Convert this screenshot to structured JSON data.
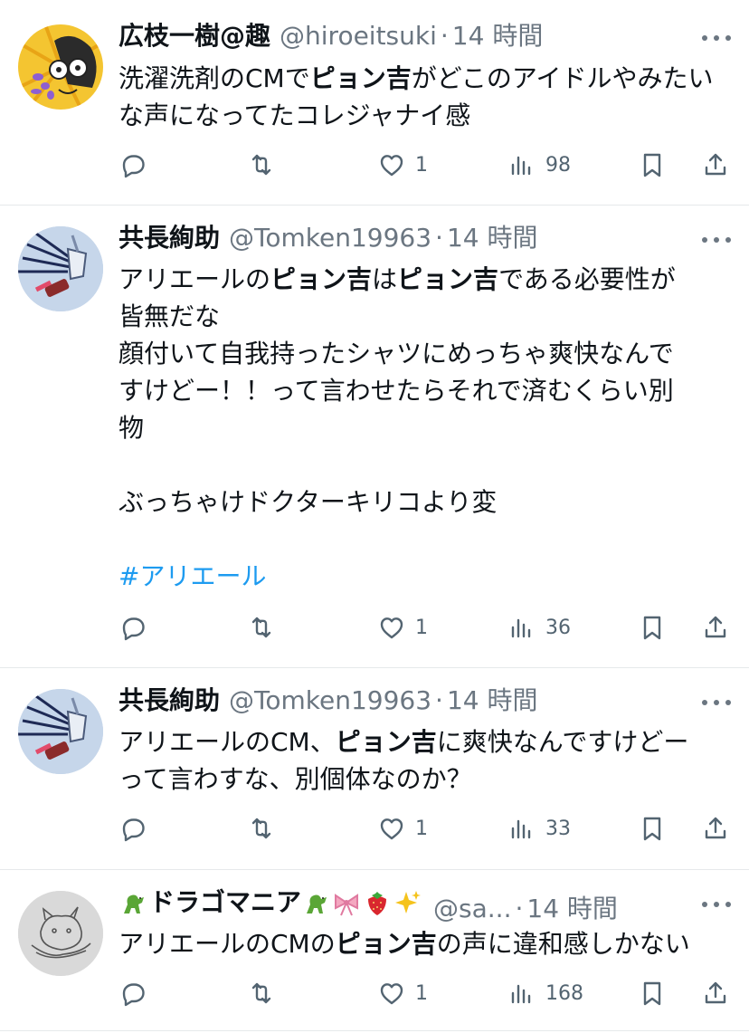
{
  "tweets": [
    {
      "name": "広枝一樹@趣",
      "handle": "@hiroeitsuki",
      "sep": "·",
      "time": "14 時間",
      "text_parts": [
        "洗濯洗剤のCMで",
        "ピョン吉",
        "がどこのアイドルやみたい",
        "な声になってたコレジャナイ感"
      ],
      "likes": "1",
      "views": "98"
    },
    {
      "name": "共長絢助",
      "handle": "@Tomken19963",
      "sep": "·",
      "time": "14 時間",
      "text_parts": [
        "アリエールの",
        "ピョン吉",
        "は",
        "ピョン吉",
        "である必要性が\n皆無だな\n顔付いて自我持ったシャツにめっちゃ爽快なんで\nすけどー！！って言わせたらそれで済むくらい別\n物\n\nぶっちゃけドクターキリコより変\n\n"
      ],
      "hashtag": "#アリエール",
      "likes": "1",
      "views": "36"
    },
    {
      "name": "共長絢助",
      "handle": "@Tomken19963",
      "sep": "·",
      "time": "14 時間",
      "text_parts": [
        "アリエールのCM、",
        "ピョン吉",
        "に爽快なんですけどー\nって言わすな、別個体なのか？"
      ],
      "likes": "1",
      "views": "33"
    },
    {
      "name": "ドラゴマニア",
      "handle": "@sa...",
      "sep": "·",
      "time": "14 時間",
      "text_parts": [
        "アリエールのCMの",
        "ピョン吉",
        "の声に違和感しかない"
      ],
      "likes": "1",
      "views": "168"
    }
  ],
  "icons": {
    "reply": "reply-icon",
    "retweet": "retweet-icon",
    "like": "heart-icon",
    "views": "views-icon",
    "bookmark": "bookmark-icon",
    "share": "share-icon",
    "more": "more-icon"
  },
  "colors": {
    "text": "#0f1419",
    "secondary": "#536471",
    "link": "#1d9bf0",
    "divider": "#e6e9eb"
  }
}
